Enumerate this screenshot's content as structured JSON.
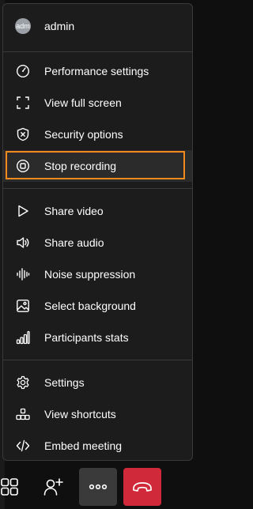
{
  "user": {
    "name": "admin",
    "avatar_initials": "adm"
  },
  "menu": {
    "group1": [
      {
        "label": "Performance settings",
        "icon": "gauge-icon"
      },
      {
        "label": "View full screen",
        "icon": "fullscreen-icon"
      },
      {
        "label": "Security options",
        "icon": "shield-icon"
      },
      {
        "label": "Stop recording",
        "icon": "stop-record-icon",
        "active": true
      }
    ],
    "group2": [
      {
        "label": "Share video",
        "icon": "play-icon"
      },
      {
        "label": "Share audio",
        "icon": "speaker-icon"
      },
      {
        "label": "Noise suppression",
        "icon": "waveform-icon"
      },
      {
        "label": "Select background",
        "icon": "image-icon"
      },
      {
        "label": "Participants stats",
        "icon": "bar-chart-icon"
      }
    ],
    "group3": [
      {
        "label": "Settings",
        "icon": "gear-icon"
      },
      {
        "label": "View shortcuts",
        "icon": "shortcuts-icon"
      },
      {
        "label": "Embed meeting",
        "icon": "code-icon"
      }
    ]
  },
  "toolbar": {
    "items": [
      "tile-view-icon",
      "invite-icon",
      "more-icon",
      "hangup-icon"
    ]
  },
  "colors": {
    "highlight": "#f28a1e",
    "hangup": "#d0293a",
    "more_bg": "#3a3a3a"
  }
}
